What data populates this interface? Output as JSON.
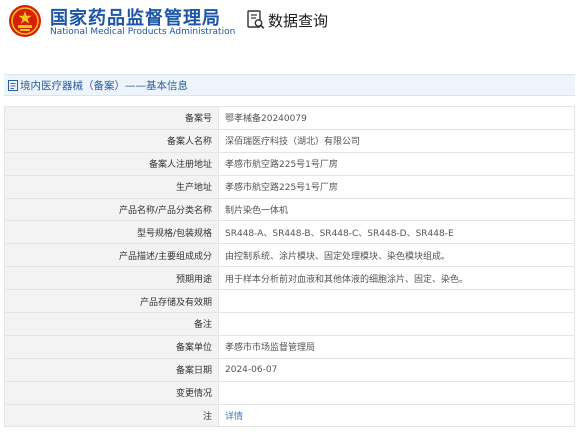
{
  "header": {
    "org_name_cn": "国家药品监督管理局",
    "org_name_en": "National Medical Products Administration",
    "query_label": "数据查询",
    "emblem_icon": "national-emblem-icon",
    "query_icon": "data-query-icon",
    "brand_color": "#1d56a6"
  },
  "section": {
    "title": "境内医疗器械（备案）——基本信息"
  },
  "rows": [
    {
      "label": "备案号",
      "value": "鄂孝械备20240079"
    },
    {
      "label": "备案人名称",
      "value": "深佰瑞医疗科技（湖北）有限公司"
    },
    {
      "label": "备案人注册地址",
      "value": "孝感市航空路225号1号厂房"
    },
    {
      "label": "生产地址",
      "value": "孝感市航空路225号1号厂房"
    },
    {
      "label": "产品名称/产品分类名称",
      "value": "制片染色一体机"
    },
    {
      "label": "型号规格/包装规格",
      "value": "SR448-A、SR448-B、SR448-C、SR448-D、SR448-E"
    },
    {
      "label": "产品描述/主要组成成分",
      "value": "由控制系统、涂片模块、固定处理模块、染色模块组成。"
    },
    {
      "label": "预期用途",
      "value": "用于样本分析前对血液和其他体液的细胞涂片、固定、染色。"
    },
    {
      "label": "产品存储及有效期",
      "value": ""
    },
    {
      "label": "备注",
      "value": ""
    },
    {
      "label": "备案单位",
      "value": "孝感市市场监督管理局"
    },
    {
      "label": "备案日期",
      "value": "2024-06-07"
    },
    {
      "label": "变更情况",
      "value": ""
    },
    {
      "label": "注",
      "value": "详情",
      "link": true
    }
  ]
}
